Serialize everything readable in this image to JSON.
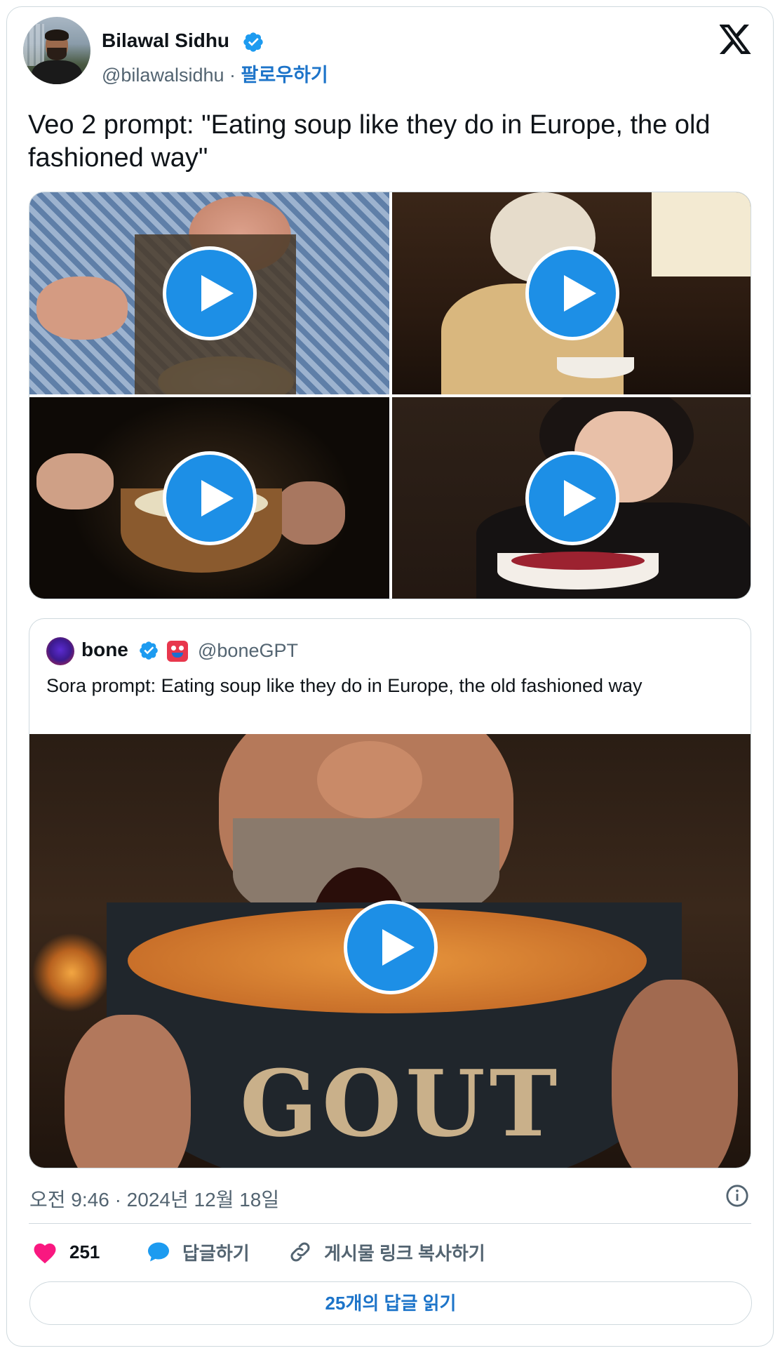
{
  "author": {
    "name": "Bilawal Sidhu",
    "handle": "@bilawalsidhu",
    "separator": " · ",
    "follow": "팔로우하기"
  },
  "tweet": {
    "text": "Veo 2 prompt: \"Eating soup like they do in Europe, the old fashioned way\""
  },
  "media": {
    "items": [
      {
        "icon": "play-icon"
      },
      {
        "icon": "play-icon"
      },
      {
        "icon": "play-icon"
      },
      {
        "icon": "play-icon"
      }
    ]
  },
  "quoted": {
    "name": "bone",
    "handle": "@boneGPT",
    "text": "Sora prompt: Eating soup like they do in Europe, the old fashioned way",
    "bowl_text": "GOUT"
  },
  "meta": {
    "timestamp": "오전 9:46 · 2024년 12월 18일"
  },
  "actions": {
    "like_count": "251",
    "reply_label": "답글하기",
    "copy_label": "게시물 링크 복사하기"
  },
  "footer": {
    "read_replies": "25개의 답글 읽기"
  },
  "colors": {
    "accent": "#1d9bf0",
    "link": "#1d74c9",
    "like": "#f91880",
    "play": "#1d8fe6"
  }
}
